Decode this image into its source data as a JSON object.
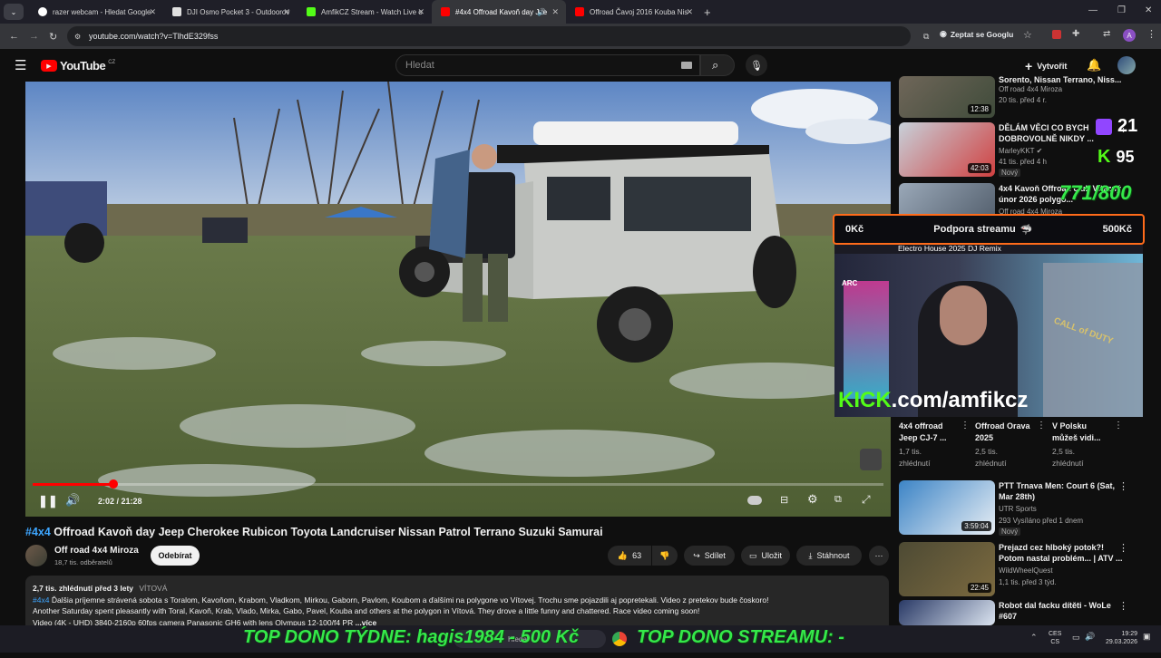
{
  "browser": {
    "tabs": [
      {
        "label": "razer webcam - Hledat Google",
        "color": "#ffffff"
      },
      {
        "label": "DJI Osmo Pocket 3 - Outdoorov",
        "color": "#ffffff"
      },
      {
        "label": "AmfikCZ Stream - Watch Live o",
        "color": "#53fc18"
      },
      {
        "label": "#4x4 Offroad Kavoň day Jee",
        "color": "#ff0000"
      },
      {
        "label": "Offroad Čavoj 2016 Kouba Nis",
        "color": "#ff0000"
      }
    ],
    "url": "youtube.com/watch?v=TlhdE329fss",
    "ask_google": "Zeptat se Googlu",
    "profile_letter": "A"
  },
  "youtube": {
    "logo": "YouTube",
    "region": "CZ",
    "search_placeholder": "Hledat",
    "create_label": "Vytvořit"
  },
  "player": {
    "time": "2:02 / 21:28",
    "progress": 0.095
  },
  "video": {
    "hashtag": "#4x4",
    "title": "Offroad Kavoň day Jeep Cherokee Rubicon Toyota Landcruiser Nissan Patrol Terrano Suzuki Samurai",
    "channel": "Off road 4x4 Miroza",
    "subscribers": "18,7 tis. odběratelů",
    "subscribe": "Odebírat",
    "likes": "63",
    "share": "Sdílet",
    "save": "Uložit",
    "download": "Stáhnout"
  },
  "description": {
    "meta": "2,7 tis. zhlédnutí  před 3 lety",
    "location": "VÍTOVÁ",
    "line1_tag": "#4x4",
    "line1": "Ďalšia príjemne strávená sobota s Toralom, Kavoňom, Krabom, Vladkom, Mirkou, Gaborn, Pavlom, Koubom a ďalšími na polygone vo Vítovej. Trochu sme pojazdili aj popretekali. Video z pretekov bude čoskoro!",
    "line2": "Another Saturday spent pleasantly with Toral, Kavoň, Krab, Vlado, Mirka, Gabo, Pavel, Kouba and others at the polygon in Vítová. They drove a little funny and chattered. Race video coming soon!",
    "line3": "Video (4K - UHD) 3840-2160p 60fps camera Panasonic GH6 with lens Olympus 12-100/f4 PR",
    "more": "...více"
  },
  "sidebar": {
    "items": [
      {
        "title": "Sorento, Nissan Terrano, Niss...",
        "channel": "Off road 4x4 Miroza",
        "meta": "20 tis.  před 4 r.",
        "duration": "12:38"
      },
      {
        "title": "DĚLÁM VĚCI CO BYCH DOBROVOLNĚ NIKDY ...",
        "channel": "MarleyKKT",
        "meta": "41 tis.  před 4 h",
        "duration": "42:03",
        "badge": "Nový"
      },
      {
        "title": "4x4 Kavoň Offroad club Vítězný únor 2026 polygo...",
        "channel": "Off road 4x4 Miroza",
        "meta": "",
        "duration": ""
      },
      {
        "title": "Electro House 2025 DJ Remix",
        "channel": "",
        "meta": "",
        "duration": ""
      },
      {
        "title": "PTT Trnava Men: Court 6 (Sat, Mar 28th)",
        "channel": "UTR Sports",
        "meta": "293  Vysíláno před 1 dnem",
        "duration": "3:59:04",
        "badge": "Nový"
      },
      {
        "title": "Prejazd cez hlboký potok?! Potom nastal problém... | ATV ...",
        "channel": "WildWheelQuest",
        "meta": "1,1 tis.  před 3 týd.",
        "duration": "22:45"
      },
      {
        "title": "Robot dal facku dítěti - WoLe #607",
        "channel": "",
        "meta": "",
        "duration": ""
      }
    ],
    "shorts": [
      {
        "title": "4x4 offroad Jeep CJ-7 ...",
        "views": "1,7 tis. zhlédnutí"
      },
      {
        "title": "Offroad Orava 2025",
        "views": "2,5 tis. zhlédnutí"
      },
      {
        "title": "V Polsku můžeš vidi...",
        "views": "2,5 tis. zhlédnutí"
      }
    ]
  },
  "stream_overlay": {
    "twitch_count": "21",
    "kick_count": "95",
    "goal": "771/800",
    "bar_left": "0Kč",
    "bar_center": "Podpora streamu",
    "bar_right": "500Kč",
    "kick_url_brand": "KICK",
    "kick_url_rest": ".com/amfikcz",
    "ticker_left": "TOP DONO TÝDNE:  hagis1984 - 500 Kč",
    "ticker_right": "TOP DONO STREAMU: -"
  },
  "taskbar": {
    "search": "Hledat",
    "lang_top": "CES",
    "lang_bottom": "CS",
    "time": "19:29",
    "date": "29.03.2026"
  }
}
